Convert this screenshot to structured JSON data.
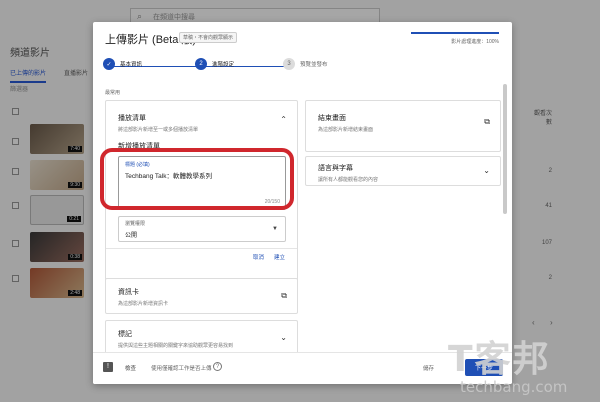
{
  "background": {
    "search_placeholder": "在頻道中搜尋",
    "channel_title": "頻道影片",
    "tabs": [
      "已上傳的影片",
      "直播影片"
    ],
    "filter_label": "篩選器",
    "column_label": "影片",
    "right_column_header": "觀看次數",
    "durations": [
      "7:40",
      "9:30",
      "0:21",
      "0:38",
      "2:48"
    ],
    "right_values": [
      "",
      "2",
      "41",
      "107",
      "2"
    ]
  },
  "dialog": {
    "title": "上傳影片 (Beta 版)",
    "draft_badge": "草稿・不會向觀眾顯示",
    "progress_text": "影片處理進度：100%",
    "progress_fraction": 1.0,
    "steps": [
      {
        "number": "✓",
        "label": "基本資訊",
        "state": "done"
      },
      {
        "number": "2",
        "label": "進階設定",
        "state": "active"
      },
      {
        "number": "3",
        "label": "預覽並發布",
        "state": "inactive"
      }
    ],
    "section_label": "最常用",
    "playlist_card": {
      "title": "播放清單",
      "desc": "將這部影片新增至一或多個播放清單",
      "new_playlist_label": "新增播放清單",
      "name_field_label": "標題 (必填)",
      "name_field_value": "Techbang Talk：軟體教學系列",
      "char_count": "20/150",
      "visibility_label": "瀏覽權限",
      "visibility_value": "公開",
      "cancel_label": "取消",
      "create_label": "建立"
    },
    "infocard_card": {
      "title": "資訊卡",
      "desc": "為這部影片新增資訊卡"
    },
    "tags_card": {
      "title": "標記",
      "desc": "提供與這些主題相關的關鍵字來協助觀眾更容易找到"
    },
    "endscreen_card": {
      "title": "結束畫面",
      "desc": "為這部影片新增結束畫面"
    },
    "subs_card": {
      "title": "語言與字幕",
      "desc": "讓所有人都能觀看您的內容"
    },
    "footer": {
      "checks_label": "檢查",
      "note": "使用僅確認工作是否上傳",
      "save_text": "儲存",
      "next_label": "下一步"
    }
  },
  "watermark": {
    "big": "T客邦",
    "small": "techbang.com"
  },
  "colors": {
    "accent": "#1f4fb5",
    "highlight_ring": "#d0272d"
  }
}
